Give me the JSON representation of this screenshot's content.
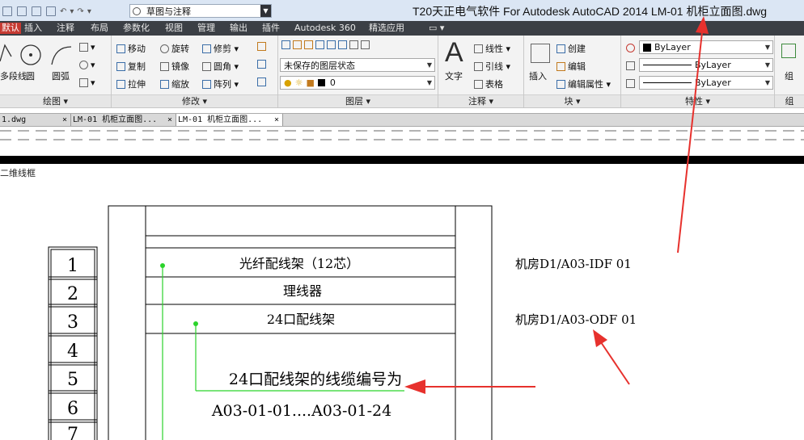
{
  "window": {
    "title": "T20天正电气软件 For Autodesk AutoCAD 2014      LM-01 机柜立面图.dwg"
  },
  "quick_access": {
    "workspace": "草图与注释"
  },
  "ribbon_tabs": [
    "默认",
    "插入",
    "注释",
    "布局",
    "参数化",
    "视图",
    "管理",
    "输出",
    "插件",
    "Autodesk 360",
    "精选应用"
  ],
  "ribbon": {
    "draw": {
      "title": "绘图 ▾",
      "items": [
        "多段线",
        "圆",
        "圆弧"
      ]
    },
    "modify": {
      "title": "修改 ▾",
      "rows": [
        [
          "移动",
          "旋转",
          "修剪 ▾"
        ],
        [
          "复制",
          "镜像",
          "圆角 ▾"
        ],
        [
          "拉伸",
          "缩放",
          "阵列 ▾"
        ]
      ]
    },
    "layers": {
      "title": "图层 ▾",
      "state": "未保存的图层状态",
      "current": "0"
    },
    "annotation": {
      "title": "注释 ▾",
      "text": "文字",
      "items": [
        "线性 ▾",
        "引线 ▾",
        "表格"
      ]
    },
    "block": {
      "title": "块 ▾",
      "insert": "插入",
      "items": [
        "创建",
        "编辑",
        "编辑属性 ▾"
      ]
    },
    "properties": {
      "title": "特性 ▾",
      "color": "ByLayer",
      "linetype": "ByLayer",
      "lineweight": "ByLayer"
    },
    "group": {
      "title": "组",
      "label": "组"
    }
  },
  "doc_tabs": [
    "1.dwg",
    "LM-01 机柜立面图...",
    "LM-01 机柜立面图..."
  ],
  "viewport_label": "二维线框",
  "drawing": {
    "numbers": [
      "1",
      "2",
      "3",
      "4",
      "5",
      "6",
      "7"
    ],
    "rows": [
      "光纤配线架（12芯）",
      "理线器",
      "24口配线架"
    ],
    "labels": [
      "机房D1/A03-IDF 01",
      "机房D1/A03-ODF 01"
    ],
    "annotation_line1": "24口配线架的线缆编号为",
    "annotation_line2": "A03-01-01....A03-01-24"
  }
}
